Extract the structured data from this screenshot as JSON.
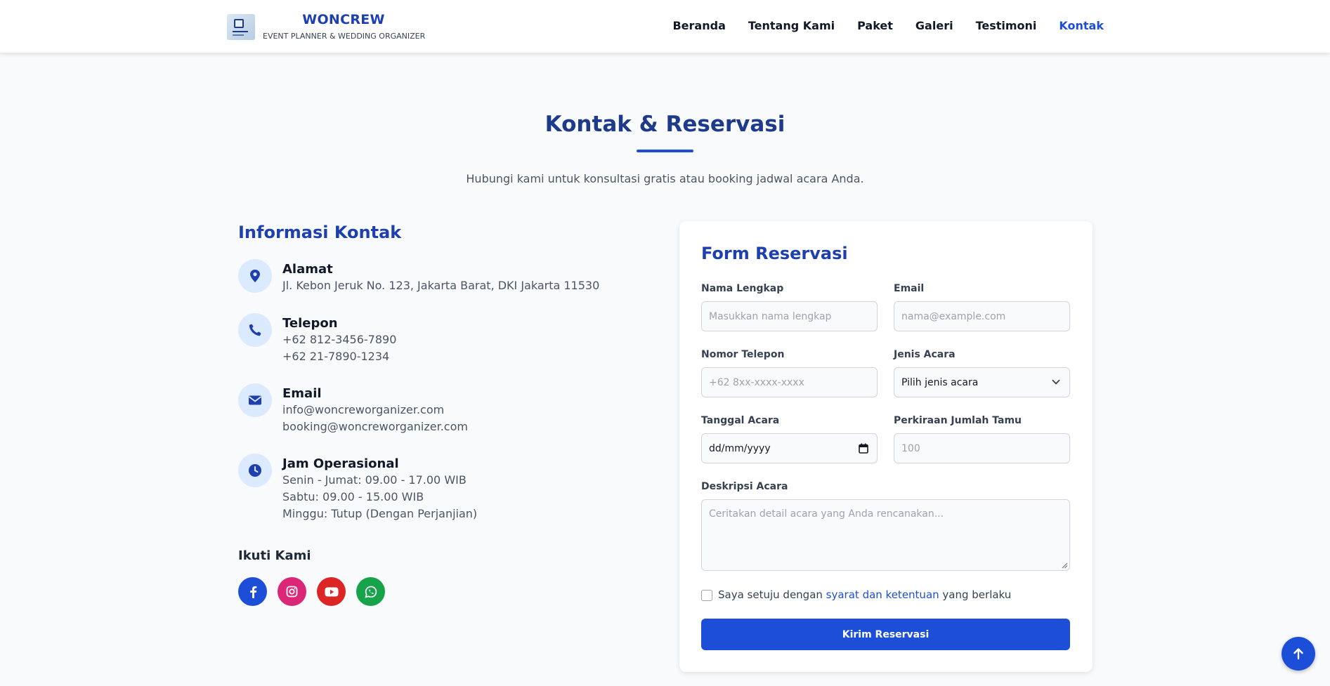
{
  "brand": {
    "name": "WONCREW",
    "tagline": "EVENT PLANNER & WEDDING ORGANIZER"
  },
  "nav": {
    "items": [
      "Beranda",
      "Tentang Kami",
      "Paket",
      "Galeri",
      "Testimoni",
      "Kontak"
    ],
    "active": "Kontak"
  },
  "section": {
    "title": "Kontak & Reservasi",
    "subtitle": "Hubungi kami untuk konsultasi gratis atau booking jadwal acara Anda."
  },
  "contact": {
    "title": "Informasi Kontak",
    "address": {
      "label": "Alamat",
      "lines": [
        "Jl. Kebon Jeruk No. 123, Jakarta Barat, DKI Jakarta 11530"
      ],
      "icon": "map-pin-icon"
    },
    "phone": {
      "label": "Telepon",
      "lines": [
        "+62 812-3456-7890",
        "+62 21-7890-1234"
      ],
      "icon": "phone-icon"
    },
    "email": {
      "label": "Email",
      "lines": [
        "info@woncreworganizer.com",
        "booking@woncreworganizer.com"
      ],
      "icon": "envelope-icon"
    },
    "hours": {
      "label": "Jam Operasional",
      "lines": [
        "Senin - Jumat: 09.00 - 17.00 WIB",
        "Sabtu: 09.00 - 15.00 WIB",
        "Minggu: Tutup (Dengan Perjanjian)"
      ],
      "icon": "clock-icon"
    }
  },
  "social": {
    "title": "Ikuti Kami",
    "items": [
      {
        "icon": "facebook-icon",
        "color": "#1d4ed8"
      },
      {
        "icon": "instagram-icon",
        "color": "#db2777"
      },
      {
        "icon": "youtube-icon",
        "color": "#dc2626"
      },
      {
        "icon": "whatsapp-icon",
        "color": "#16a34a"
      }
    ]
  },
  "form": {
    "title": "Form Reservasi",
    "name": {
      "label": "Nama Lengkap",
      "placeholder": "Masukkan nama lengkap"
    },
    "email": {
      "label": "Email",
      "placeholder": "nama@example.com"
    },
    "phone": {
      "label": "Nomor Telepon",
      "placeholder": "+62 8xx-xxxx-xxxx"
    },
    "event_type": {
      "label": "Jenis Acara",
      "selected": "Pilih jenis acara"
    },
    "date": {
      "label": "Tanggal Acara",
      "value": "dd/mm/yyyy"
    },
    "guests": {
      "label": "Perkiraan Jumlah Tamu",
      "placeholder": "100"
    },
    "description": {
      "label": "Deskripsi Acara",
      "placeholder": "Ceritakan detail acara yang Anda rencanakan..."
    },
    "agree": {
      "prefix": "Saya setuju dengan ",
      "link": "syarat dan ketentuan",
      "suffix": " yang berlaku"
    },
    "submit": "Kirim Reservasi"
  },
  "colors": {
    "primary": "#1d4ed8",
    "heading": "#1e3a8a",
    "icon_bg": "#dbeafe"
  }
}
